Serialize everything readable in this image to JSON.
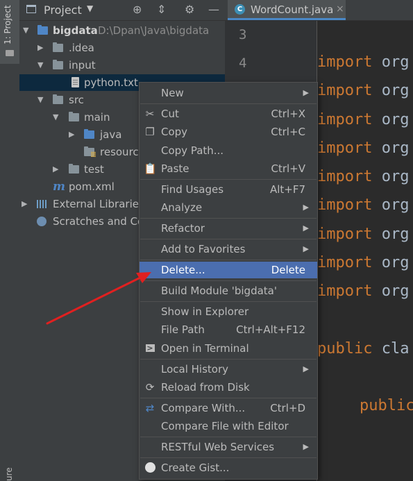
{
  "tool_window": {
    "project_tab_label": "1: Project",
    "structure_tab_label": "ure"
  },
  "project_panel": {
    "title": "Project",
    "tree": {
      "root_name": "bigdata",
      "root_path": "D:\\Dpan\\Java\\bigdata",
      "idea": ".idea",
      "input": "input",
      "python_file": "python.txt",
      "src": "src",
      "main": "main",
      "java": "java",
      "resources": "resources",
      "test": "test",
      "pom": "pom.xml",
      "external_libraries": "External Libraries",
      "scratches": "Scratches and Consoles"
    }
  },
  "editor": {
    "tab_label": "WordCount.java",
    "line_numbers": [
      "3",
      "4"
    ],
    "code_lines": {
      "import_kw": "import",
      "import_rest": " org",
      "public_kw": "public",
      "public_rest": " cla",
      "indented_public": "public"
    }
  },
  "context_menu": {
    "new": "New",
    "cut": "Cut",
    "cut_shortcut": "Ctrl+X",
    "copy": "Copy",
    "copy_shortcut": "Ctrl+C",
    "copy_path": "Copy Path...",
    "paste": "Paste",
    "paste_shortcut": "Ctrl+V",
    "find_usages": "Find Usages",
    "find_usages_shortcut": "Alt+F7",
    "analyze": "Analyze",
    "refactor": "Refactor",
    "add_to_favorites": "Add to Favorites",
    "delete": "Delete...",
    "delete_shortcut": "Delete",
    "build_module": "Build Module 'bigdata'",
    "show_in_explorer": "Show in Explorer",
    "file_path": "File Path",
    "file_path_shortcut": "Ctrl+Alt+F12",
    "open_in_terminal": "Open in Terminal",
    "local_history": "Local History",
    "reload_from_disk": "Reload from Disk",
    "compare_with": "Compare With...",
    "compare_with_shortcut": "Ctrl+D",
    "compare_file_with_editor": "Compare File with Editor",
    "restful_web_services": "RESTful Web Services",
    "create_gist": "Create Gist..."
  },
  "colors": {
    "highlight": "#4b6eaf",
    "keyword": "#cc7832",
    "annotation_arrow": "#e02020"
  }
}
